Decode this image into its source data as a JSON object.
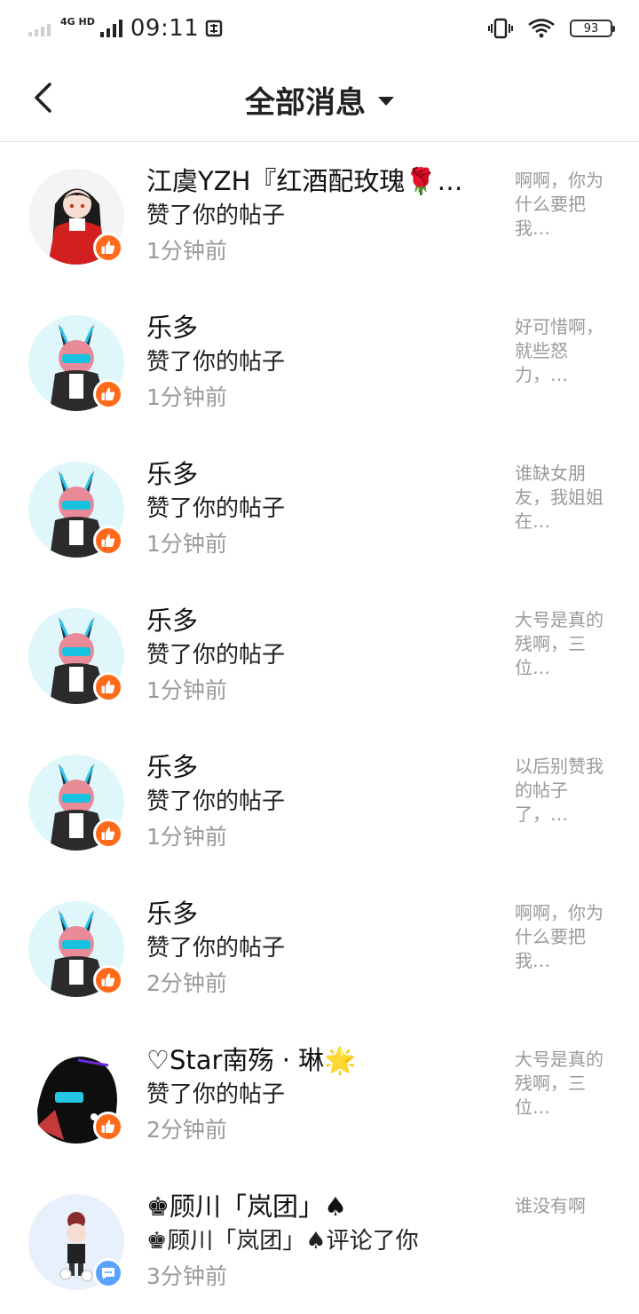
{
  "status_bar": {
    "network": "4G HD",
    "time": "09:11",
    "battery": "93"
  },
  "nav": {
    "title": "全部消息"
  },
  "messages": [
    {
      "name": "江虞YZH『红酒配玫瑰🌹…",
      "action": "赞了你的帖子",
      "time": "1分钟前",
      "preview": "啊啊，你为什么要把我…",
      "type": "like",
      "avatar": "girl-red-dress"
    },
    {
      "name": "乐多",
      "action": "赞了你的帖子",
      "time": "1分钟前",
      "preview": "好可惜啊，就些怒力，…",
      "type": "like",
      "avatar": "bunny-girl"
    },
    {
      "name": "乐多",
      "action": "赞了你的帖子",
      "time": "1分钟前",
      "preview": "谁缺女朋友，我姐姐在…",
      "type": "like",
      "avatar": "bunny-girl"
    },
    {
      "name": "乐多",
      "action": "赞了你的帖子",
      "time": "1分钟前",
      "preview": "大号是真的残啊，三位…",
      "type": "like",
      "avatar": "bunny-girl"
    },
    {
      "name": "乐多",
      "action": "赞了你的帖子",
      "time": "1分钟前",
      "preview": "以后别赞我的帖子了，…",
      "type": "like",
      "avatar": "bunny-girl"
    },
    {
      "name": "乐多",
      "action": "赞了你的帖子",
      "time": "2分钟前",
      "preview": "啊啊，你为什么要把我…",
      "type": "like",
      "avatar": "bunny-girl"
    },
    {
      "name": "♡Star南殇 · 琳🌟",
      "action": "赞了你的帖子",
      "time": "2分钟前",
      "preview": "大号是真的残啊，三位…",
      "type": "like",
      "avatar": "dark-hair-girl"
    },
    {
      "name": "♚顾川「岚团」♠",
      "action": "♚顾川「岚团」♠评论了你",
      "time": "3分钟前",
      "preview": "谁没有啊",
      "type": "comment",
      "avatar": "chibi-girl"
    }
  ],
  "colors": {
    "like_badge": "#ff6b1a",
    "comment_badge": "#5aa2ff",
    "secondary_text": "#9a9a9a"
  }
}
